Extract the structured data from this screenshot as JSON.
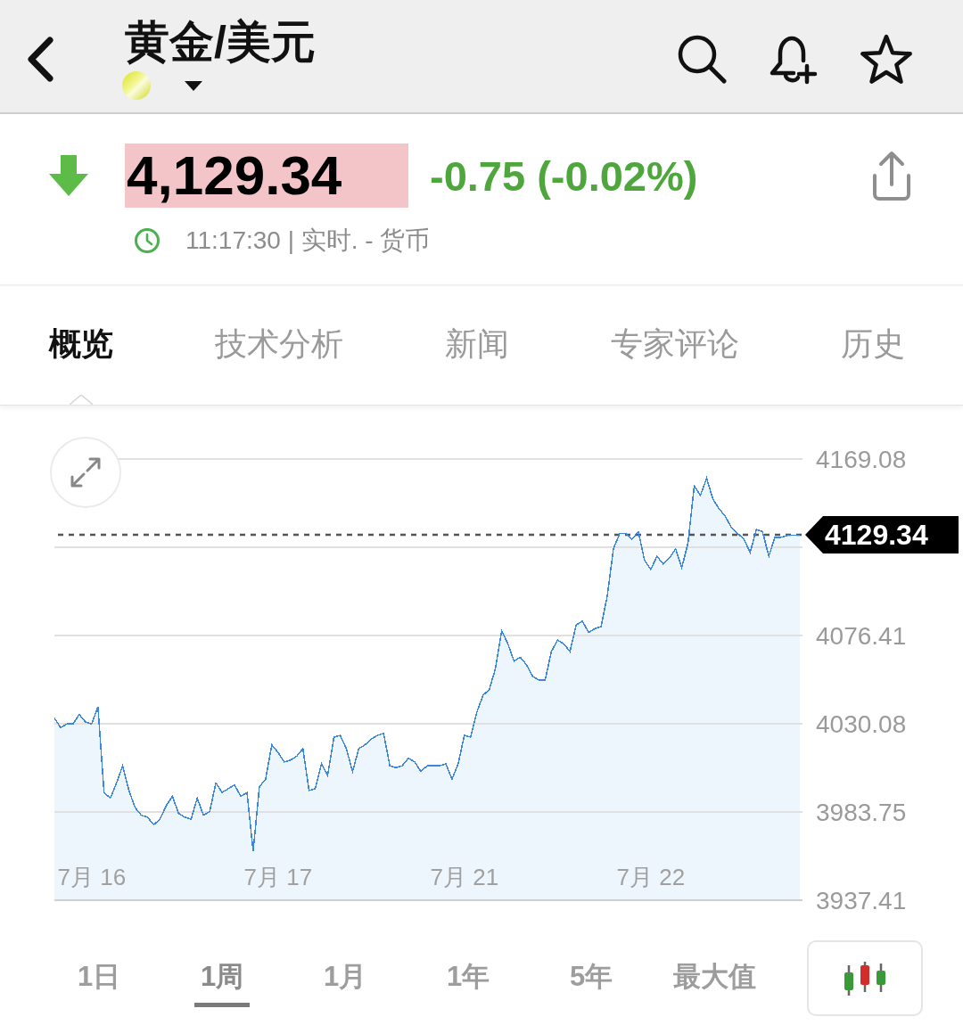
{
  "header": {
    "title": "黄金/美元"
  },
  "quote": {
    "falling": true,
    "flash": true,
    "price": "4,129.34",
    "change": "-0.75 (-0.02%)",
    "time": "11:17:30 | 实时. - 货币"
  },
  "tabs": [
    {
      "label": "概览",
      "selected": true
    },
    {
      "label": "技术分析",
      "selected": false
    },
    {
      "label": "新闻",
      "selected": false
    },
    {
      "label": "专家评论",
      "selected": false
    },
    {
      "label": "历史",
      "selected": false
    }
  ],
  "chart": {
    "chart_data": {
      "type": "area",
      "grid": true,
      "ylim": [
        3937.41,
        4169.08
      ],
      "yticks": [
        3937.41,
        3983.75,
        4030.08,
        4076.41,
        4169.08
      ],
      "categories": [
        null,
        null,
        null,
        null,
        null,
        null,
        "7月 16",
        null,
        null,
        null,
        null,
        null,
        null,
        null,
        null,
        null,
        null,
        null,
        null,
        null,
        null,
        null,
        null,
        null,
        null,
        null,
        null,
        null,
        null,
        null,
        null,
        null,
        null,
        null,
        null,
        null,
        "7月 17",
        null,
        null,
        null,
        null,
        null,
        null,
        null,
        null,
        null,
        null,
        null,
        null,
        null,
        null,
        null,
        null,
        null,
        null,
        null,
        null,
        null,
        null,
        null,
        null,
        null,
        null,
        null,
        null,
        null,
        "7月 21",
        null,
        null,
        null,
        null,
        null,
        null,
        null,
        null,
        null,
        null,
        null,
        null,
        null,
        null,
        null,
        null,
        null,
        null,
        null,
        null,
        null,
        null,
        null,
        null,
        null,
        null,
        null,
        null,
        null,
        "7月 22",
        null,
        null,
        null,
        null,
        null,
        null,
        null,
        null,
        null,
        null,
        null,
        null,
        null,
        null,
        null,
        null,
        null,
        null,
        null,
        null,
        null,
        null,
        null,
        null
      ],
      "series": [
        {
          "values": [
            4033,
            4028,
            4030,
            4030,
            4035,
            4031,
            4030,
            4039,
            3994,
            3991,
            3999,
            4008,
            3995,
            3986,
            3982,
            3981,
            3977,
            3980,
            3987,
            3992,
            3983,
            3981,
            3980,
            3991,
            3982,
            3984,
            3999,
            3994,
            3996,
            3998,
            3992,
            3994,
            3963,
            3997,
            4001,
            4019,
            4015,
            4010,
            4011,
            4013,
            4017,
            3995,
            3996,
            4009,
            4003,
            4023,
            4024,
            4017,
            4005,
            4017,
            4019,
            4022,
            4024,
            4025,
            4008,
            4007,
            4008,
            4012,
            4010,
            4005,
            4008,
            4008,
            4008,
            4009,
            4001,
            4009,
            4024,
            4023,
            4036,
            4045,
            4048,
            4059,
            4079,
            4072,
            4063,
            4065,
            4061,
            4055,
            4053,
            4053,
            4068,
            4074,
            4072,
            4068,
            4082,
            4084,
            4078,
            4080,
            4081,
            4097,
            4122,
            4130,
            4130,
            4127,
            4131,
            4116,
            4111,
            4118,
            4114,
            4117,
            4122,
            4112,
            4125,
            4155,
            4150,
            4159,
            4148,
            4143,
            4139,
            4133,
            4130,
            4127,
            4120,
            4132,
            4131,
            4118,
            4128,
            4128,
            4129,
            4129,
            4129
          ]
        }
      ],
      "ref_lines": [
        {
          "axis": "y",
          "value": 4129.34,
          "label": "4129.34"
        }
      ]
    }
  },
  "ranges": [
    {
      "label": "1日",
      "selected": false
    },
    {
      "label": "1周",
      "selected": true
    },
    {
      "label": "1月",
      "selected": false
    },
    {
      "label": "1年",
      "selected": false
    },
    {
      "label": "5年",
      "selected": false
    },
    {
      "label": "最大值",
      "selected": false
    }
  ]
}
